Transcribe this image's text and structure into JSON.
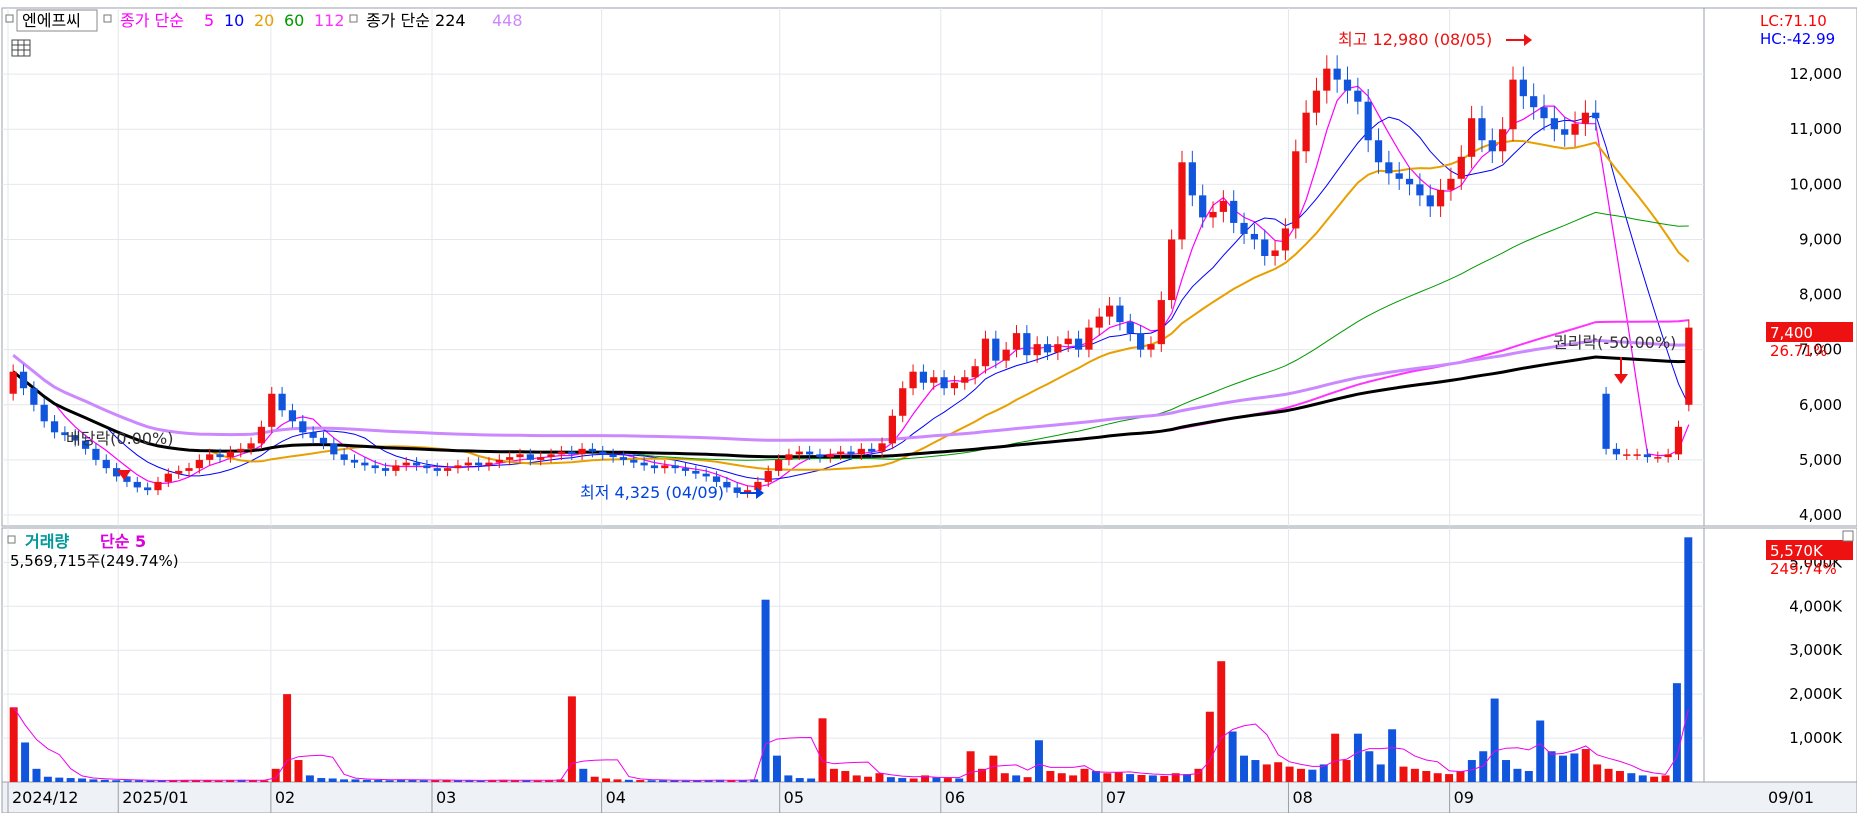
{
  "header": {
    "stock_name": "엔에프씨",
    "ma_label": "종가 단순",
    "ma_periods": [
      "5",
      "10",
      "20",
      "60",
      "112"
    ],
    "ma_colors": [
      "#ff00ff",
      "#0000ff",
      "#e8a000",
      "#009900",
      "#ff33ff"
    ],
    "ma2_label": "종가 단순 224",
    "ma2_extra": "448"
  },
  "readouts": {
    "lc": "LC:71.10",
    "hc": "HC:-42.99",
    "price_tag": "7,400",
    "price_change": "26.71%",
    "volume_tag": "5,570K",
    "volume_change": "249.74%"
  },
  "annotations": {
    "high": "최고 12,980 (08/05)",
    "low": "최저 4,325 (04/09)",
    "dividend": "배당락(0.00%)",
    "rights": "권리락(-50.00%)"
  },
  "volume_panel": {
    "title": "거래량",
    "ma_label": "단순 5",
    "value_text": "5,569,715주(249.74%)"
  },
  "axis": {
    "price_ticks": [
      "4,000",
      "5,000",
      "6,000",
      "7,000",
      "8,000",
      "9,000",
      "10,000",
      "11,000",
      "12,000"
    ],
    "volume_ticks": [
      "1,000K",
      "2,000K",
      "3,000K",
      "4,000K",
      "5,000K"
    ],
    "x_labels": [
      "2024/12",
      "2025/01",
      "02",
      "03",
      "04",
      "05",
      "06",
      "07",
      "08",
      "09"
    ],
    "x_right_label": "09/01"
  },
  "chart_data": [
    {
      "type": "candlestick",
      "title": "엔에프씨",
      "ylim": [
        3800,
        13200
      ],
      "y_ticks": [
        4000,
        5000,
        6000,
        7000,
        8000,
        9000,
        10000,
        11000,
        12000
      ],
      "x_labels": [
        "2024/12",
        "2025/01",
        "02",
        "03",
        "04",
        "05",
        "06",
        "07",
        "08",
        "09"
      ],
      "candles_close": [
        6600,
        6300,
        6000,
        5700,
        5500,
        5450,
        5350,
        5200,
        5000,
        4850,
        4700,
        4600,
        4500,
        4450,
        4600,
        4750,
        4800,
        4850,
        5000,
        5100,
        5050,
        5150,
        5200,
        5300,
        5600,
        6200,
        5900,
        5700,
        5500,
        5400,
        5300,
        5100,
        5000,
        4950,
        4900,
        4850,
        4800,
        4900,
        4950,
        4900,
        4850,
        4800,
        4850,
        4900,
        4950,
        4900,
        4950,
        5000,
        5050,
        5100,
        5000,
        5050,
        5100,
        5150,
        5100,
        5200,
        5150,
        5100,
        5050,
        5000,
        4950,
        4900,
        4850,
        4900,
        4850,
        4800,
        4750,
        4700,
        4600,
        4500,
        4400,
        4450,
        4600,
        4800,
        5000,
        5100,
        5150,
        5100,
        5050,
        5100,
        5150,
        5100,
        5200,
        5150,
        5300,
        5800,
        6300,
        6600,
        6400,
        6500,
        6300,
        6400,
        6500,
        6700,
        7200,
        6800,
        7000,
        7300,
        6900,
        7100,
        6950,
        7100,
        7200,
        7000,
        7400,
        7600,
        7800,
        7500,
        7300,
        7000,
        7100,
        7900,
        9000,
        10400,
        9800,
        9400,
        9500,
        9700,
        9300,
        9100,
        9000,
        8700,
        8800,
        9200,
        10600,
        11300,
        11700,
        12100,
        11900,
        11700,
        11500,
        10800,
        10400,
        10200,
        10100,
        10000,
        9800,
        9600,
        9900,
        10100,
        10500,
        11200,
        10800,
        10600,
        11000,
        11900,
        11600,
        11400,
        11200,
        11000,
        10900,
        11100,
        11300,
        11200,
        5200,
        5100,
        5100,
        5100,
        5050,
        5050,
        5100,
        5600,
        7400
      ],
      "candles_open": [
        6200,
        6600,
        6300,
        6000,
        5700,
        5500,
        5450,
        5350,
        5200,
        5000,
        4850,
        4700,
        4600,
        4500,
        4450,
        4600,
        4750,
        4800,
        4850,
        5000,
        5100,
        5050,
        5150,
        5200,
        5300,
        5600,
        6200,
        5900,
        5700,
        5500,
        5400,
        5300,
        5100,
        5000,
        4950,
        4900,
        4850,
        4800,
        4900,
        4950,
        4900,
        4850,
        4800,
        4850,
        4900,
        4950,
        4900,
        4950,
        5000,
        5050,
        5100,
        5000,
        5050,
        5100,
        5150,
        5100,
        5200,
        5150,
        5100,
        5050,
        5000,
        4950,
        4900,
        4850,
        4900,
        4850,
        4800,
        4750,
        4700,
        4600,
        4500,
        4400,
        4450,
        4600,
        4800,
        5000,
        5100,
        5150,
        5100,
        5050,
        5100,
        5150,
        5100,
        5200,
        5150,
        5300,
        5800,
        6300,
        6600,
        6400,
        6500,
        6300,
        6400,
        6500,
        6700,
        7200,
        6800,
        7000,
        7300,
        6900,
        7100,
        6950,
        7100,
        7200,
        7000,
        7400,
        7600,
        7800,
        7500,
        7300,
        7000,
        7100,
        7900,
        9000,
        10400,
        9800,
        9400,
        9500,
        9700,
        9300,
        9100,
        9000,
        8700,
        8800,
        9200,
        10600,
        11300,
        11700,
        12100,
        11900,
        11700,
        11500,
        10800,
        10400,
        10200,
        10100,
        10000,
        9800,
        9600,
        9900,
        10100,
        10500,
        11200,
        10800,
        10600,
        11000,
        11900,
        11600,
        11400,
        11200,
        11000,
        10900,
        11100,
        11300,
        6200,
        5200,
        5100,
        5100,
        5100,
        5050,
        5050,
        5100,
        6000
      ],
      "high": 12980,
      "high_date": "08/05",
      "low": 4325,
      "low_date": "04/09",
      "last_close": 7400,
      "ma5_last": 5600,
      "ma60_last": 9150,
      "ma224_last": 6400,
      "ma448_last": 7300
    },
    {
      "type": "bar",
      "title": "거래량",
      "ylim": [
        0,
        5600
      ],
      "y_ticks": [
        1000,
        2000,
        3000,
        4000,
        5000
      ],
      "values_k": [
        1700,
        900,
        300,
        120,
        100,
        90,
        80,
        60,
        50,
        40,
        40,
        35,
        30,
        40,
        40,
        45,
        40,
        35,
        30,
        40,
        50,
        40,
        35,
        300,
        2000,
        500,
        150,
        90,
        80,
        60,
        60,
        50,
        45,
        40,
        60,
        50,
        40,
        35,
        45,
        40,
        35,
        30,
        45,
        50,
        40,
        35,
        30,
        40,
        60,
        1950,
        300,
        120,
        80,
        60,
        50,
        45,
        40,
        40,
        35,
        30,
        40,
        45,
        50,
        40,
        35,
        60,
        4150,
        600,
        150,
        90,
        80,
        1450,
        300,
        250,
        150,
        120,
        200,
        110,
        90,
        80,
        150,
        100,
        90,
        80,
        700,
        300,
        600,
        200,
        150,
        110,
        950,
        250,
        200,
        150,
        300,
        250,
        200,
        220,
        180,
        160,
        150,
        140,
        200,
        180,
        300,
        1600,
        2750,
        1150,
        600,
        500,
        400,
        450,
        350,
        300,
        280,
        400,
        1100,
        500,
        1100,
        700,
        400,
        1200,
        350,
        300,
        250,
        200,
        180,
        250,
        500,
        700,
        1900,
        500,
        300,
        250,
        1400,
        700,
        600,
        650,
        750,
        400,
        300,
        250,
        200,
        150,
        120,
        150,
        2250,
        5570
      ]
    }
  ]
}
